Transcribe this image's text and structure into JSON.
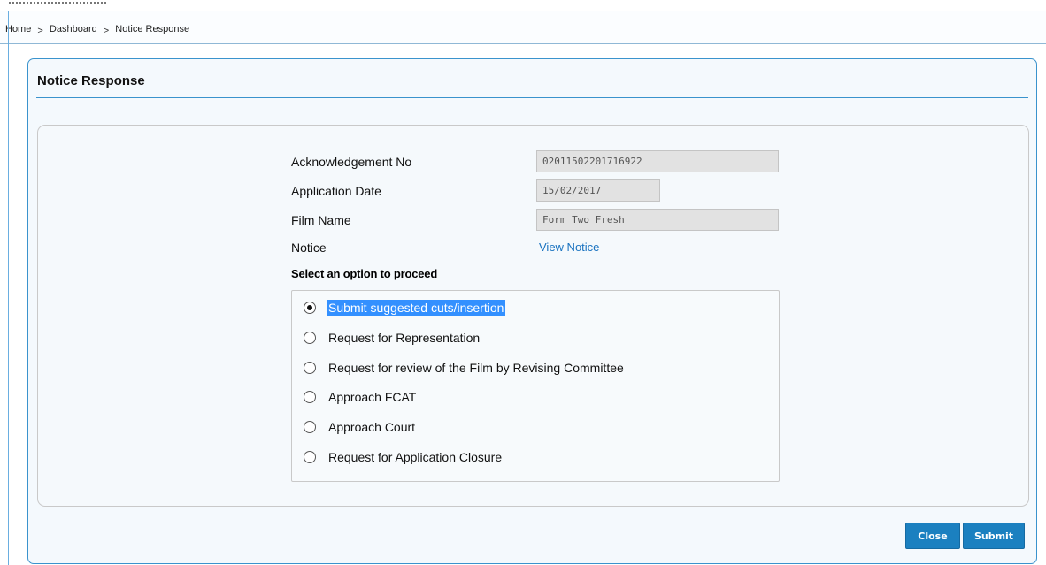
{
  "breadcrumb": {
    "items": [
      "Home",
      "Dashboard",
      "Notice Response"
    ],
    "separator": ">"
  },
  "panel": {
    "title": "Notice Response"
  },
  "form": {
    "acknowledgement": {
      "label": "Acknowledgement No",
      "value": "02011502201716922"
    },
    "application_date": {
      "label": "Application Date",
      "value": "15/02/2017"
    },
    "film_name": {
      "label": "Film Name",
      "value": "Form Two Fresh"
    },
    "notice": {
      "label": "Notice",
      "link_text": "View Notice"
    }
  },
  "options": {
    "heading": "Select an option to proceed",
    "selected_index": 0,
    "items": [
      "Submit suggested cuts/insertion",
      "Request for Representation",
      "Request for review of the Film by Revising Committee",
      "Approach FCAT",
      "Approach Court",
      "Request for Application Closure"
    ]
  },
  "buttons": {
    "close_label": "Close",
    "submit_label": "Submit"
  },
  "colors": {
    "accent": "#1b80c0",
    "panel_border": "#3a93cd",
    "link": "#1a73c0",
    "selection": "#3390ff"
  }
}
